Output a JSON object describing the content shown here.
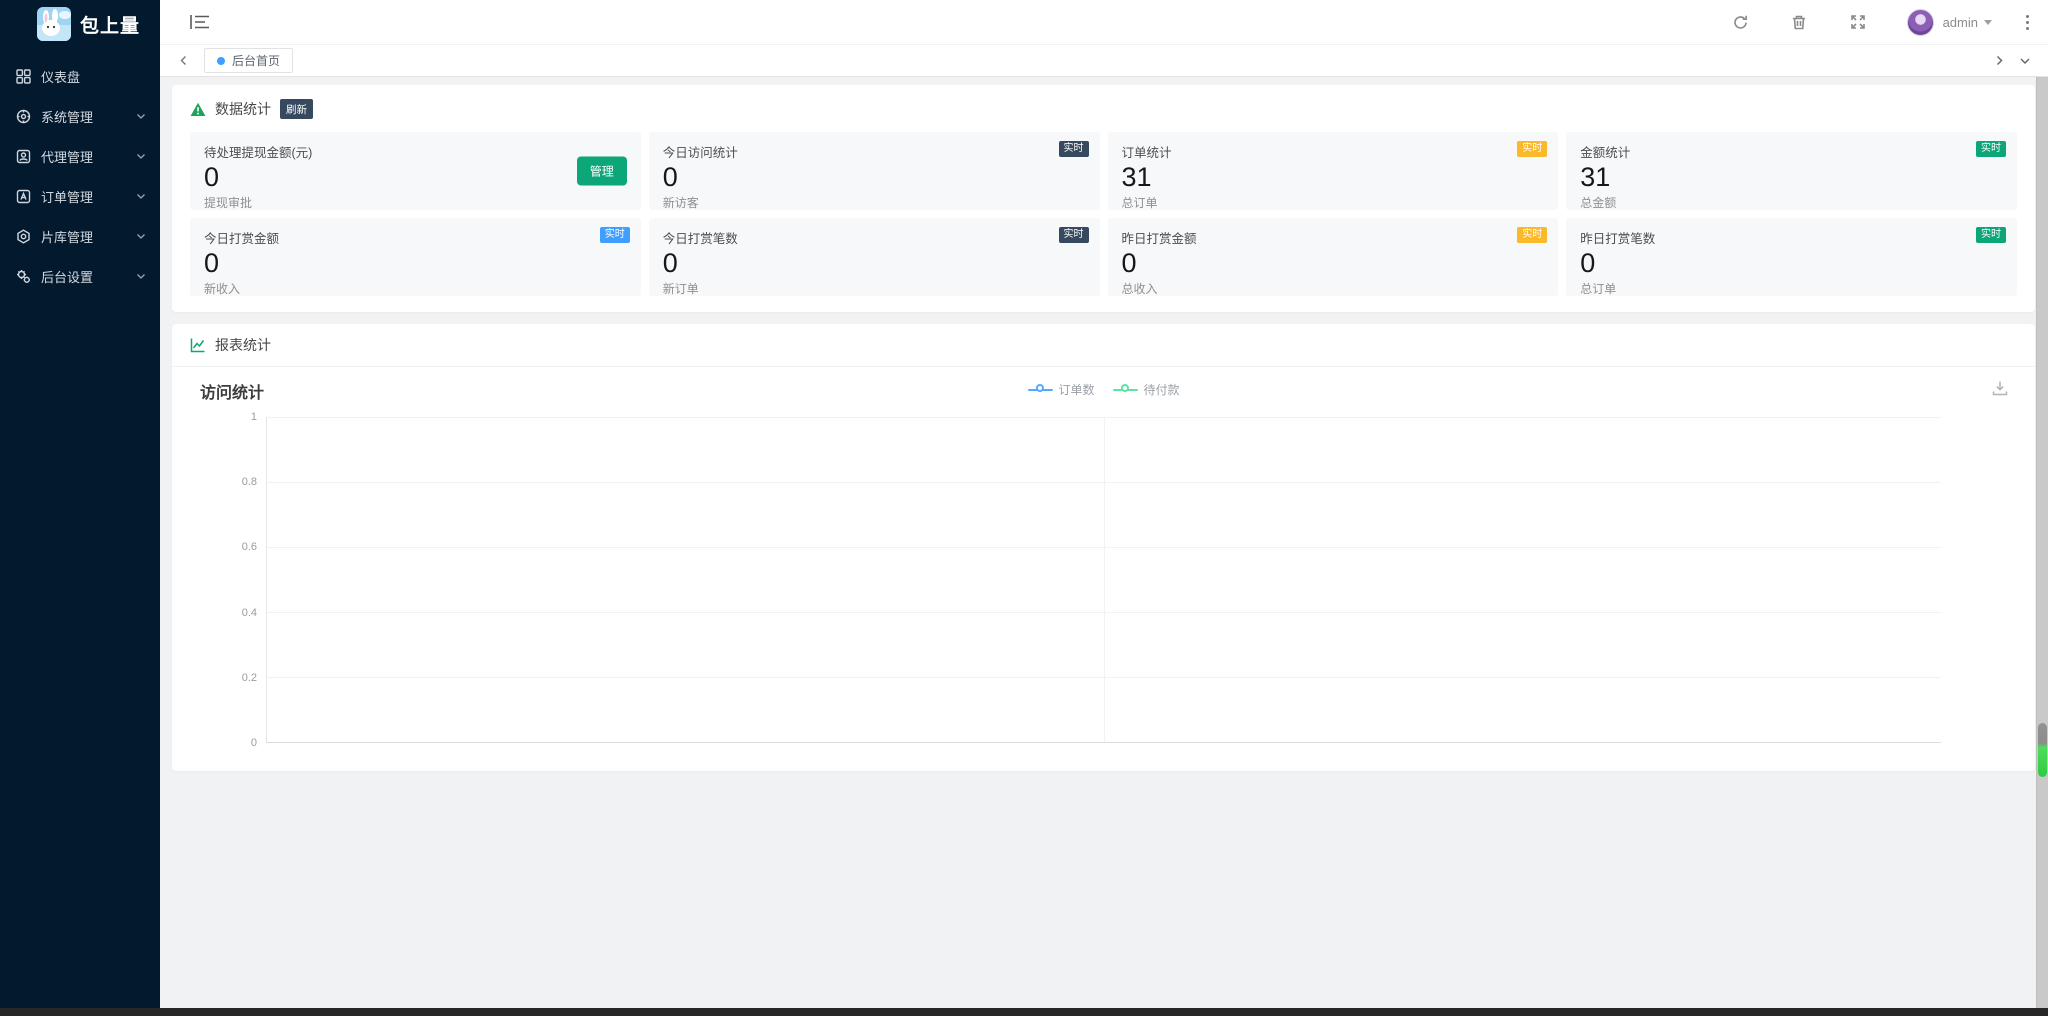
{
  "app": {
    "title": "包上量"
  },
  "sidebar": {
    "items": [
      {
        "label": "仪表盘",
        "icon": "dashboard-icon",
        "expandable": false
      },
      {
        "label": "系统管理",
        "icon": "system-icon",
        "expandable": true
      },
      {
        "label": "代理管理",
        "icon": "agent-icon",
        "expandable": true
      },
      {
        "label": "订单管理",
        "icon": "order-icon",
        "expandable": true
      },
      {
        "label": "片库管理",
        "icon": "library-icon",
        "expandable": true
      },
      {
        "label": "后台设置",
        "icon": "settings-icon",
        "expandable": true
      }
    ]
  },
  "header": {
    "user": "admin"
  },
  "tabs": {
    "active": "后台首页"
  },
  "stats_panel": {
    "title": "数据统计",
    "refresh_badge": "刷新",
    "cards": [
      {
        "title": "待处理提现金额(元)",
        "value": "0",
        "footer": "提现审批",
        "action": "管理"
      },
      {
        "title": "今日访问统计",
        "value": "0",
        "footer": "新访客",
        "badge": "实时",
        "badge_color": "#36495e"
      },
      {
        "title": "订单统计",
        "value": "31",
        "footer": "总订单",
        "badge": "实时",
        "badge_color": "#fbb829"
      },
      {
        "title": "金额统计",
        "value": "31",
        "footer": "总金额",
        "badge": "实时",
        "badge_color": "#0ca678"
      },
      {
        "title": "今日打赏金额",
        "value": "0",
        "footer": "新收入",
        "badge": "实时",
        "badge_color": "#409eff"
      },
      {
        "title": "今日打赏笔数",
        "value": "0",
        "footer": "新订单",
        "badge": "实时",
        "badge_color": "#36495e"
      },
      {
        "title": "昨日打赏金额",
        "value": "0",
        "footer": "总收入",
        "badge": "实时",
        "badge_color": "#fbb829"
      },
      {
        "title": "昨日打赏笔数",
        "value": "0",
        "footer": "总订单",
        "badge": "实时",
        "badge_color": "#0ca678"
      }
    ]
  },
  "report_panel": {
    "title": "报表统计"
  },
  "chart_data": {
    "type": "line",
    "title": "访问统计",
    "series": [
      {
        "name": "订单数",
        "color": "#54a8ff",
        "values": []
      },
      {
        "name": "待付款",
        "color": "#5fe3a1",
        "values": []
      }
    ],
    "categories": [],
    "xlabel": "",
    "ylabel": "",
    "ylim": [
      0,
      1
    ],
    "y_ticks": [
      "1",
      "0.8",
      "0.6",
      "0.4",
      "0.2",
      "0"
    ],
    "grid": true,
    "legend_position": "top-center",
    "note": "chart area is empty — no data points plotted"
  },
  "colors": {
    "sidebar_bg": "#03192e",
    "accent_teal": "#0ca678",
    "accent_blue": "#409eff",
    "accent_yellow": "#fbb829",
    "badge_dark": "#36495e",
    "tab_dot": "#409eff",
    "content_bg": "#f0f2f4"
  }
}
